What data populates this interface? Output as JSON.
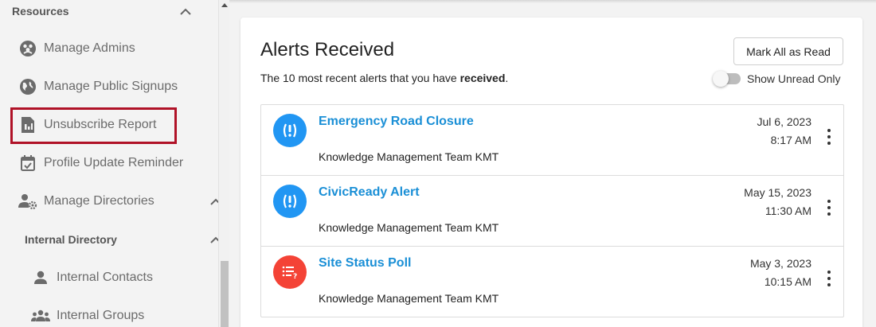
{
  "sidebar": {
    "resources_label": "Resources",
    "items": [
      {
        "label": "Manage Admins",
        "icon": "admins-icon"
      },
      {
        "label": "Manage Public Signups",
        "icon": "globe-icon"
      },
      {
        "label": "Unsubscribe Report",
        "icon": "report-icon"
      },
      {
        "label": "Profile Update Reminder",
        "icon": "calendar-check-icon"
      },
      {
        "label": "Manage Directories",
        "icon": "directory-settings-icon"
      }
    ],
    "internal_directory_label": "Internal Directory",
    "sub_items": [
      {
        "label": "Internal Contacts",
        "icon": "person-icon"
      },
      {
        "label": "Internal Groups",
        "icon": "group-icon"
      }
    ]
  },
  "main": {
    "title": "Alerts Received",
    "subtitle_prefix": "The 10 most recent alerts that you have ",
    "subtitle_bold": "received",
    "subtitle_suffix": ".",
    "mark_all_label": "Mark All as Read",
    "toggle_label": "Show Unread Only",
    "alerts": [
      {
        "title": "Emergency Road Closure",
        "sender": "Knowledge Management Team KMT",
        "date": "Jul 6, 2023",
        "time": "8:17 AM",
        "icon": "alert-exclamation-icon",
        "color": "#2196f3"
      },
      {
        "title": "CivicReady Alert",
        "sender": "Knowledge Management Team KMT",
        "date": "May 15, 2023",
        "time": "11:30 AM",
        "icon": "alert-exclamation-icon",
        "color": "#2196f3"
      },
      {
        "title": "Site Status Poll",
        "sender": "Knowledge Management Team KMT",
        "date": "May 3, 2023",
        "time": "10:15 AM",
        "icon": "poll-icon",
        "color": "#f44336"
      }
    ]
  },
  "colors": {
    "highlight_border": "#b01227",
    "link": "#1a8fd6"
  }
}
